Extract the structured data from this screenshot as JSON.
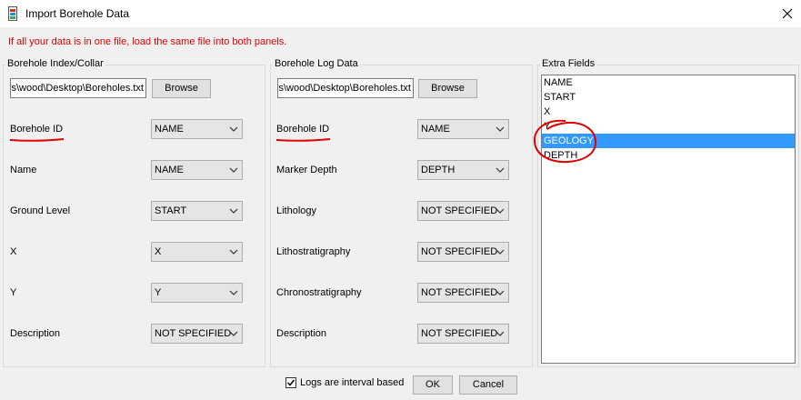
{
  "window": {
    "title": "Import Borehole Data"
  },
  "notice": "If all your data is in one file, load the same file into both panels.",
  "index_panel": {
    "title": "Borehole Index/Collar",
    "file_path": "C:\\Users\\wood\\Desktop\\Boreholes.txt",
    "browse_label": "Browse",
    "fields": [
      {
        "label": "Borehole ID",
        "value": "NAME"
      },
      {
        "label": "Name",
        "value": "NAME"
      },
      {
        "label": "Ground Level",
        "value": "START"
      },
      {
        "label": "X",
        "value": "X"
      },
      {
        "label": "Y",
        "value": "Y"
      },
      {
        "label": "Description",
        "value": "NOT SPECIFIED"
      }
    ]
  },
  "log_panel": {
    "title": "Borehole Log Data",
    "file_path": "C:\\Users\\wood\\Desktop\\Boreholes.txt",
    "browse_label": "Browse",
    "fields": [
      {
        "label": "Borehole ID",
        "value": "NAME"
      },
      {
        "label": "Marker Depth",
        "value": "DEPTH"
      },
      {
        "label": "Lithology",
        "value": "NOT SPECIFIED"
      },
      {
        "label": "Lithostratigraphy",
        "value": "NOT SPECIFIED"
      },
      {
        "label": "Chronostratigraphy",
        "value": "NOT SPECIFIED"
      },
      {
        "label": "Description",
        "value": "NOT SPECIFIED"
      }
    ]
  },
  "extra_fields": {
    "title": "Extra Fields",
    "items": [
      "NAME",
      "START",
      "X",
      "Y",
      "GEOLOGY",
      "DEPTH"
    ],
    "selected": "GEOLOGY"
  },
  "footer": {
    "interval_checkbox_label": "Logs are interval based",
    "interval_checked": true,
    "ok_label": "OK",
    "cancel_label": "Cancel"
  },
  "colors": {
    "notice": "#e00000",
    "selection": "#3399ff",
    "annotation": "#e00000"
  },
  "icons": {
    "app": "borehole-app-icon",
    "close": "close-icon",
    "dropdown": "chevron-down-icon",
    "checkbox": "checkmark-icon"
  }
}
